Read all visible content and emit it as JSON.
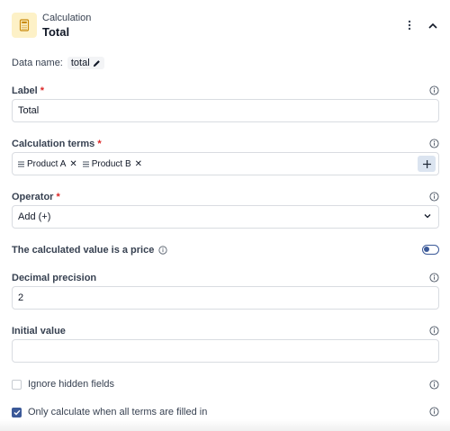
{
  "header": {
    "kind": "Calculation",
    "title": "Total",
    "icon": "calculator-icon",
    "accent": "#fdf1c7"
  },
  "data_name": {
    "label": "Data name:",
    "value": "total"
  },
  "fields": {
    "label": {
      "label": "Label",
      "value": "Total"
    },
    "terms": {
      "label": "Calculation terms",
      "chips": [
        {
          "label": "Product A"
        },
        {
          "label": "Product B"
        }
      ]
    },
    "operator": {
      "label": "Operator",
      "value": "Add (+)"
    },
    "price_toggle": {
      "label": "The calculated value is a price",
      "on": false
    },
    "decimal": {
      "label": "Decimal precision",
      "value": "2"
    },
    "initial": {
      "label": "Initial value",
      "value": ""
    },
    "ignore_hidden": {
      "label": "Ignore hidden fields",
      "checked": false
    },
    "only_when_filled": {
      "label": "Only calculate when all terms are filled in",
      "checked": true
    }
  },
  "colors": {
    "primary": "#3b5998",
    "required": "#dc2626",
    "add_button_bg": "#dbe4f0"
  }
}
